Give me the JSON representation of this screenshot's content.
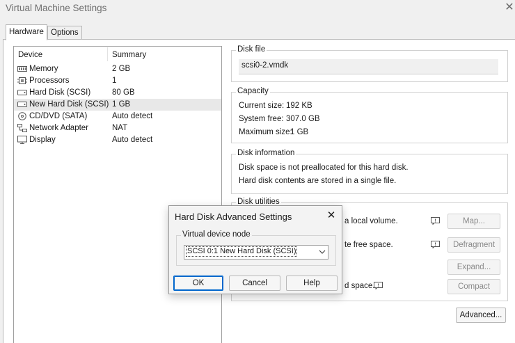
{
  "window": {
    "title": "Virtual Machine Settings"
  },
  "tabs": [
    {
      "label": "Hardware",
      "active": true
    },
    {
      "label": "Options",
      "active": false
    }
  ],
  "device_list": {
    "columns": [
      "Device",
      "Summary"
    ],
    "rows": [
      {
        "icon": "memory-icon",
        "device": "Memory",
        "summary": "2 GB"
      },
      {
        "icon": "processor-icon",
        "device": "Processors",
        "summary": "1"
      },
      {
        "icon": "hard-disk-icon",
        "device": "Hard Disk (SCSI)",
        "summary": "80 GB"
      },
      {
        "icon": "hard-disk-icon",
        "device": "New Hard Disk (SCSI)",
        "summary": "1 GB",
        "selected": true
      },
      {
        "icon": "cd-dvd-icon",
        "device": "CD/DVD (SATA)",
        "summary": "Auto detect"
      },
      {
        "icon": "network-adapter-icon",
        "device": "Network Adapter",
        "summary": "NAT"
      },
      {
        "icon": "display-icon",
        "device": "Display",
        "summary": "Auto detect"
      }
    ]
  },
  "disk_file": {
    "label": "Disk file",
    "value": "scsi0-2.vmdk"
  },
  "capacity": {
    "label": "Capacity",
    "current_label": "Current size:",
    "current_value": "192 KB",
    "free_label": "System free:",
    "free_value": "307.0 GB",
    "max_label": "Maximum size:",
    "max_value": "1 GB"
  },
  "disk_information": {
    "label": "Disk information",
    "line1": "Disk space is not preallocated for this hard disk.",
    "line2": "Hard disk contents are stored in a single file."
  },
  "disk_utilities": {
    "label": "Disk utilities",
    "map_text": "a local volume.",
    "defrag_text": "te free space.",
    "compact_text": "d space.",
    "map_button": "Map...",
    "defragment_button": "Defragment",
    "expand_button": "Expand...",
    "compact_button": "Compact"
  },
  "advanced_button": "Advanced...",
  "dialog": {
    "title": "Hard Disk Advanced Settings",
    "group_label": "Virtual device node",
    "selected_value": "SCSI 0:1  New Hard Disk (SCSI)",
    "ok": "OK",
    "cancel": "Cancel",
    "help": "Help"
  },
  "colors": {
    "accent": "#0066cc",
    "selected_row": "#e8e8e8"
  }
}
